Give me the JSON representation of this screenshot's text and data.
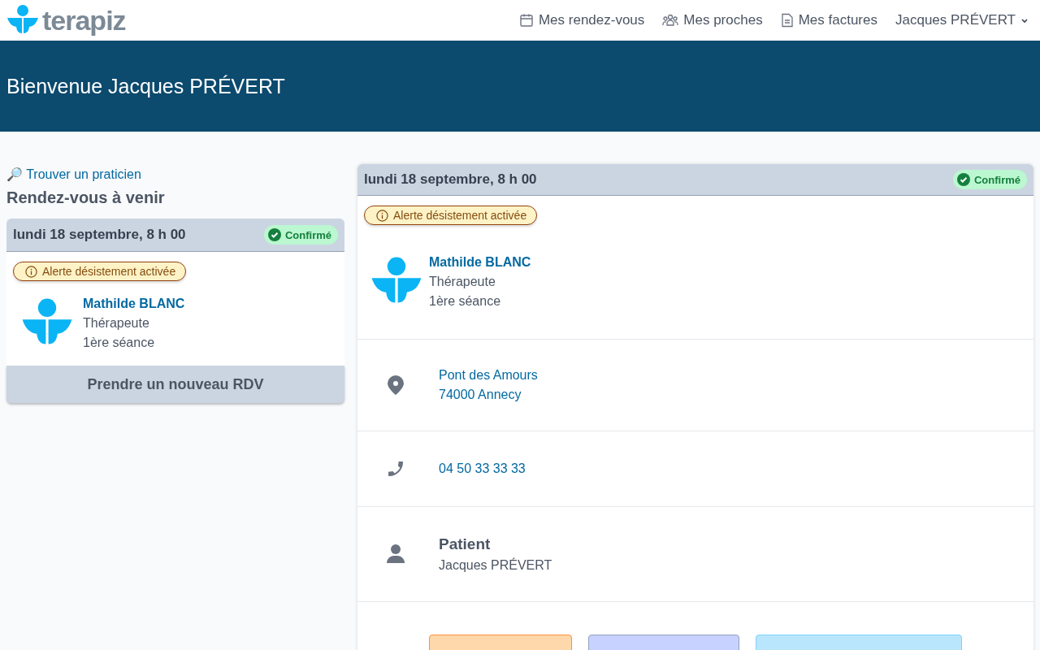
{
  "brand": {
    "name": "terapiz"
  },
  "nav": [
    {
      "kind": "calendar",
      "label": "Mes rendez-vous"
    },
    {
      "kind": "people",
      "label": "Mes proches"
    },
    {
      "kind": "document",
      "label": "Mes factures"
    }
  ],
  "user_menu": {
    "label": "Jacques PRÉVERT"
  },
  "banner": {
    "title": "Bienvenue Jacques PRÉVERT"
  },
  "sidebar": {
    "search_link": "🔎 Trouver un praticien",
    "heading": "Rendez-vous à venir",
    "appointments": [
      {
        "date": "lundi 18 septembre, 8 h 00",
        "status": "Confirmé",
        "alert": "Alerte désistement activée",
        "practitioner": "Mathilde BLANC",
        "role": "Thérapeute",
        "session": "1ère séance"
      }
    ],
    "new_button": "Prendre un nouveau RDV"
  },
  "detail": {
    "date": "lundi 18 septembre, 8 h 00",
    "status": "Confirmé",
    "alert": "Alerte désistement activée",
    "practitioner": "Mathilde BLANC",
    "role": "Thérapeute",
    "session": "1ère séance",
    "address": [
      "Pont des Amours",
      "74000 Annecy"
    ],
    "phone": "04 50 33 33 33",
    "patient_label": "Patient",
    "patient": "Jacques PRÉVERT",
    "actions": [
      {
        "color": "#fed7aa"
      },
      {
        "color": "#c7d2fe"
      },
      {
        "color": "#bae6fd"
      }
    ]
  }
}
